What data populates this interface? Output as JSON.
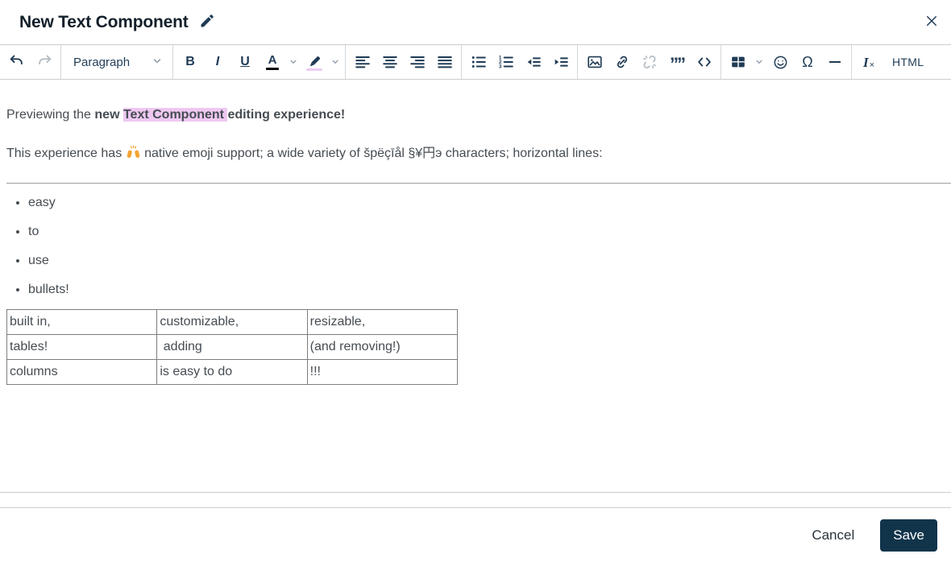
{
  "header": {
    "title": "New Text Component"
  },
  "toolbar": {
    "paragraph": "Paragraph",
    "bold": "B",
    "italic": "I",
    "underline": "U",
    "text_color": "A",
    "quote": "””",
    "omega": "Ω",
    "clear_format_i": "I",
    "clear_format_x": "×",
    "html": "HTML"
  },
  "content": {
    "p1_prefix": "Previewing the ",
    "p1_bold": "new ",
    "p1_highlight": "Text Component ",
    "p1_bold2": "editing experience!",
    "p2_before": "This experience has ",
    "p2_emoji": "🙌",
    "p2_after": " native emoji support; a wide variety of špëçīål §¥円э characters; horizontal lines:",
    "bullets": [
      "easy",
      "to",
      "use",
      "bullets!"
    ],
    "table_rows": [
      [
        "built in,",
        "customizable,",
        "resizable,"
      ],
      [
        "tables!",
        " adding",
        "(and removing!)"
      ],
      [
        "columns",
        "is easy to do",
        "!!!"
      ]
    ]
  },
  "footer": {
    "cancel": "Cancel",
    "save": "Save"
  },
  "colors": {
    "icon": "#1f3b55",
    "icon_disabled": "#b4bcc3",
    "chevron": "#8b98a4",
    "accent": "#12344b",
    "highlight": "#efc8f2",
    "pen_underline": "#eeccf4",
    "text_color_bar": "#000000",
    "text": "#454c52",
    "title_text": "#131f2a",
    "footer_text": "#28323c",
    "border": "#cccccc",
    "separator": "#d2d8dd",
    "table_border": "#7d7d7d",
    "hr": "#9aa0a5",
    "emoji_hand": "#f3a433"
  }
}
